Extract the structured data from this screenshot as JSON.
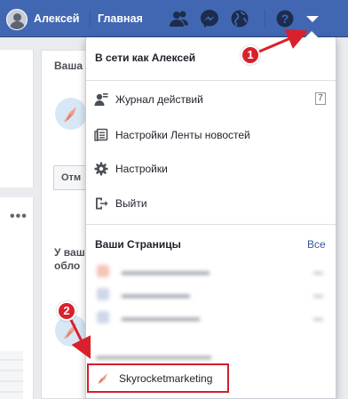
{
  "topbar": {
    "user_name": "Алексей",
    "home_label": "Главная",
    "icons": [
      "friends-icon",
      "messenger-icon",
      "globe-icon",
      "help-icon",
      "dropdown-arrow-icon"
    ],
    "bg_color": "#4267b2"
  },
  "background": {
    "card_title": "Ваша",
    "button_label": "Отм",
    "text_line1": "У ваш",
    "text_line2": "обло",
    "more_dots": "•••"
  },
  "dropdown": {
    "header": "В сети как Алексей",
    "items": [
      {
        "label": "Журнал действий",
        "icon": "activity-log-icon",
        "badge": "7"
      },
      {
        "label": "Настройки Ленты новостей",
        "icon": "newsfeed-icon"
      },
      {
        "label": "Настройки",
        "icon": "gear-icon"
      },
      {
        "label": "Выйти",
        "icon": "logout-icon"
      }
    ],
    "pages_title": "Ваши Страницы",
    "pages_all": "Все",
    "highlighted_page": "Skyrocketmarketing"
  },
  "annotations": {
    "step1": "1",
    "step2": "2",
    "color": "#d9202c"
  }
}
